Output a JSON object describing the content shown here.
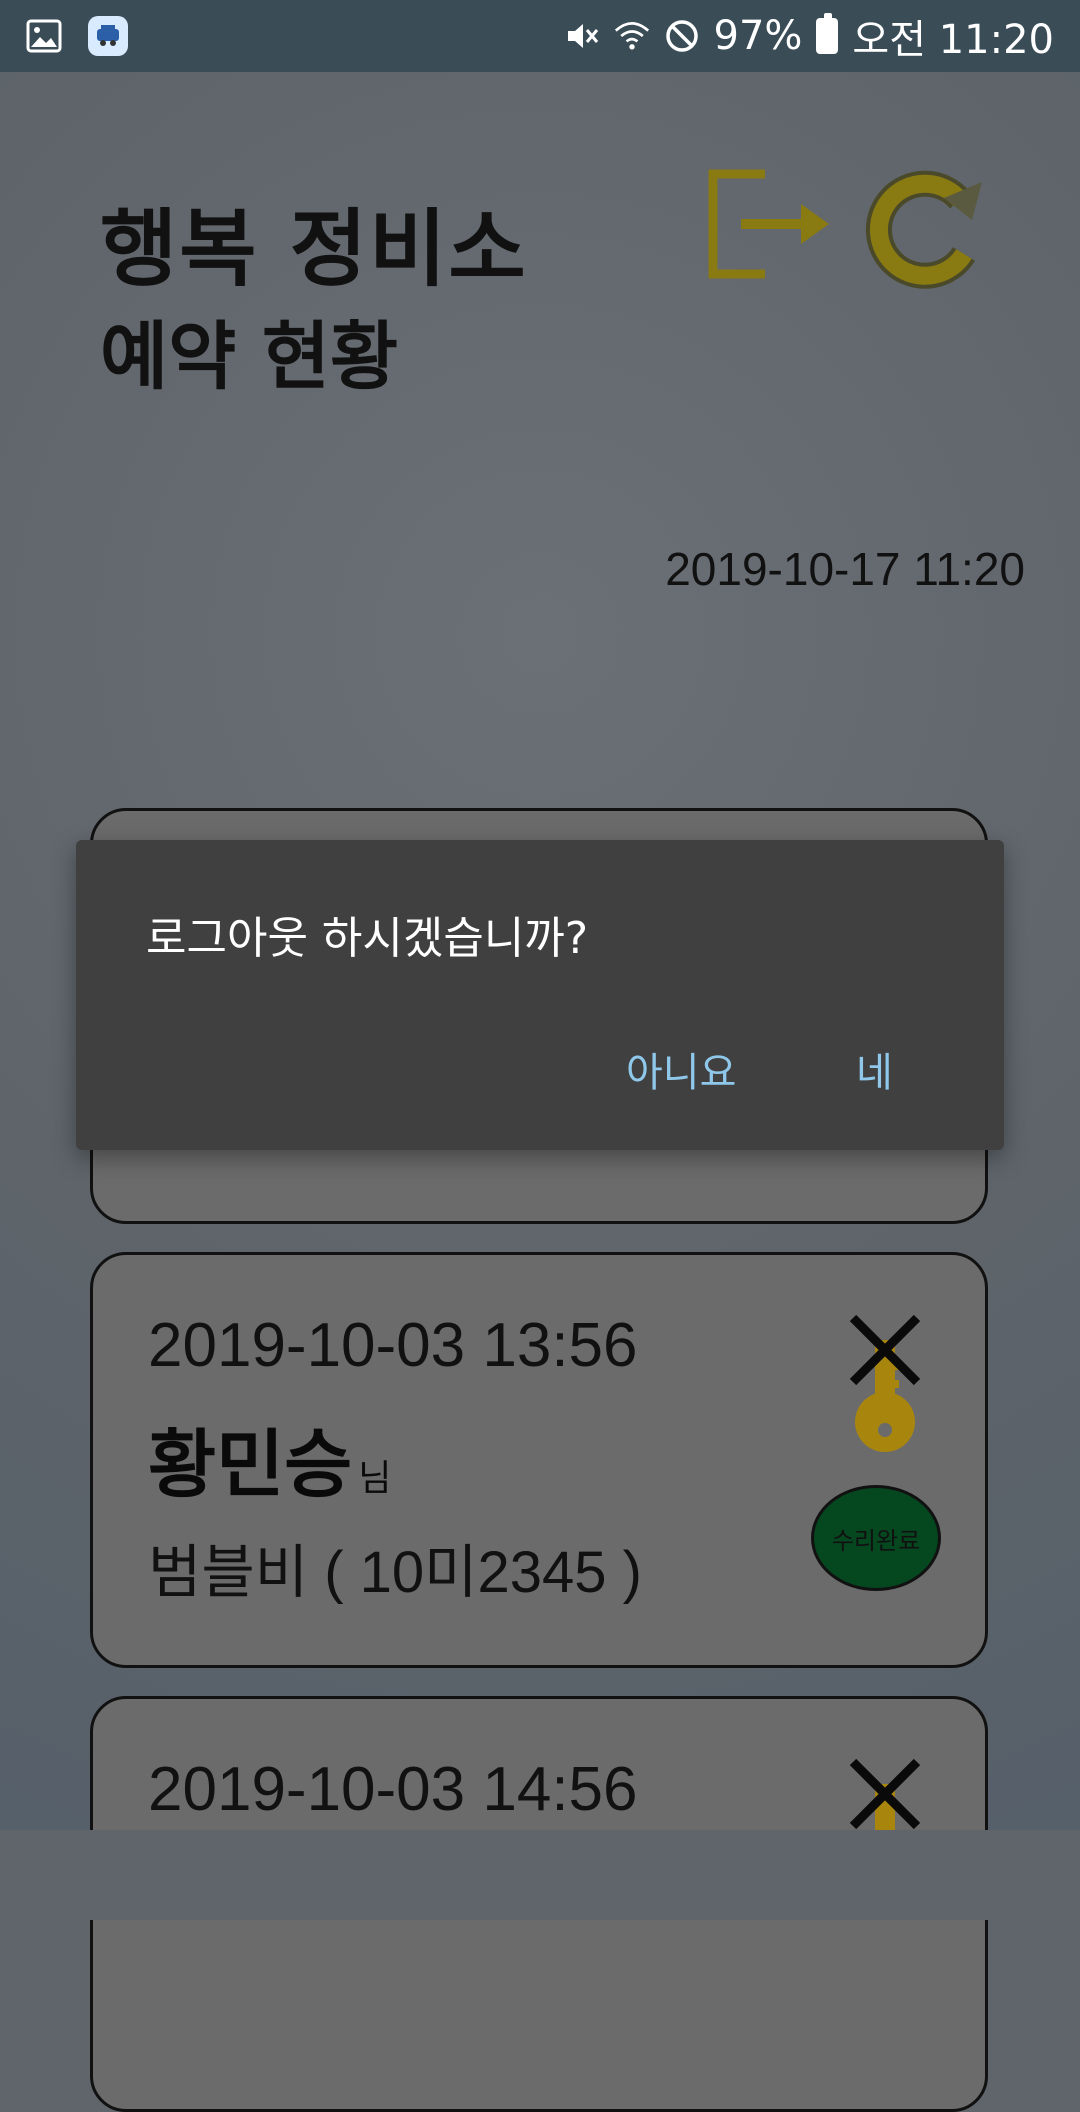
{
  "status_bar": {
    "battery": "97%",
    "time": "오전 11:20"
  },
  "app": {
    "title_line1": "행복 정비소",
    "title_line2": "예약 현황",
    "current_datetime": "2019-10-17 11:20"
  },
  "reservations": [
    {
      "datetime": "2019-10-03 13:56",
      "name": "황민승",
      "name_suffix": "님",
      "car": "범블비 ( 10미2345 )",
      "status_label": "수리완료"
    },
    {
      "datetime": "2019-10-03 14:56"
    }
  ],
  "dialog": {
    "message": "로그아웃 하시겠습니까?",
    "cancel_label": "아니요",
    "confirm_label": "네"
  }
}
